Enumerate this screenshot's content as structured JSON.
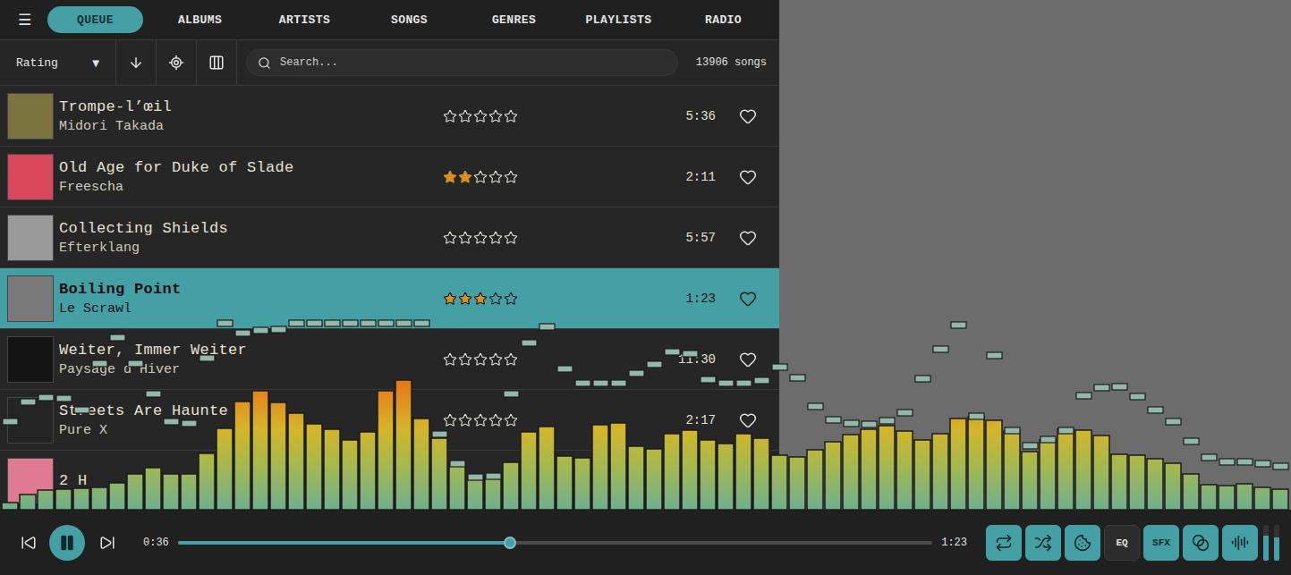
{
  "menu": {
    "glyph": "☰"
  },
  "tabs": [
    {
      "label": "QUEUE",
      "selected": true
    },
    {
      "label": "ALBUMS",
      "selected": false
    },
    {
      "label": "ARTISTS",
      "selected": false
    },
    {
      "label": "SONGS",
      "selected": false
    },
    {
      "label": "GENRES",
      "selected": false
    },
    {
      "label": "PLAYLISTS",
      "selected": false
    },
    {
      "label": "RADIO",
      "selected": false
    }
  ],
  "toolbar": {
    "sort": {
      "label": "Rating",
      "caret": "▼"
    },
    "search": {
      "placeholder": "Search..."
    },
    "count": "13906 songs"
  },
  "queue": [
    {
      "title": "Trompe-l’œil",
      "artist": "Midori Takada",
      "stars": 0,
      "duration": "5:36",
      "favorite": false,
      "selected": false,
      "color": "#7b7440"
    },
    {
      "title": "Old Age for Duke of Slade",
      "artist": "Freescha",
      "stars": 2,
      "duration": "2:11",
      "favorite": false,
      "selected": false,
      "color": "#d9475c"
    },
    {
      "title": "Collecting Shields",
      "artist": "Efterklang",
      "stars": 0,
      "duration": "5:57",
      "favorite": false,
      "selected": false,
      "color": "#9a9a9a"
    },
    {
      "title": "Boiling Point",
      "artist": "Le Scrawl",
      "stars": 3,
      "duration": "1:23",
      "favorite": false,
      "selected": true,
      "color": "#7a7a7a"
    },
    {
      "title": "Weiter, Immer Weiter",
      "artist": "Paysage d'Hiver",
      "stars": 0,
      "duration": "11:30",
      "favorite": false,
      "selected": false,
      "color": "#141414"
    },
    {
      "title": "Streets Are Haunte",
      "artist": "Pure X",
      "stars": 0,
      "duration": "2:17",
      "favorite": false,
      "selected": false,
      "color": "#242424"
    },
    {
      "title": "2 H",
      "selected": false,
      "color": "#e07a92"
    }
  ],
  "visualizer": {
    "max": 220,
    "bars": [
      8,
      17,
      22,
      23,
      24,
      25,
      30,
      40,
      47,
      40,
      40,
      63,
      91,
      121,
      133,
      120,
      108,
      96,
      90,
      78,
      87,
      133,
      145,
      102,
      80,
      51,
      35,
      37,
      53,
      87,
      93,
      60,
      58,
      95,
      97,
      71,
      68,
      85,
      89,
      78,
      74,
      85,
      80,
      61,
      59,
      67,
      76,
      84,
      90,
      94,
      88,
      78,
      85,
      102,
      104,
      100,
      88,
      65,
      78,
      90,
      89,
      83,
      62,
      61,
      57,
      52,
      40,
      28,
      27,
      29,
      25,
      23
    ],
    "peaks": [
      102,
      124,
      129,
      128,
      115,
      167,
      196,
      167,
      133,
      102,
      100,
      173,
      212,
      201,
      204,
      205,
      212,
      212,
      212,
      212,
      212,
      212,
      212,
      212,
      88,
      55,
      40,
      41,
      133,
      190,
      208,
      161,
      145,
      145,
      145,
      156,
      166,
      180,
      178,
      149,
      145,
      145,
      148,
      163,
      151,
      119,
      104,
      100,
      99,
      103,
      112,
      150,
      183,
      210,
      108,
      176,
      92,
      75,
      82,
      92,
      131,
      140,
      141,
      130,
      115,
      102,
      80,
      62,
      57,
      57,
      55,
      52
    ]
  },
  "player": {
    "playing": true,
    "elapsed": "0:36",
    "total": "1:23",
    "level": 0.44,
    "buttons": [
      {
        "kind": "repeat",
        "on": true
      },
      {
        "kind": "shuffle",
        "on": true
      },
      {
        "kind": "cookie",
        "on": true
      },
      {
        "kind": "text",
        "label": "EQ",
        "on": false
      },
      {
        "kind": "text",
        "label": "SFX",
        "on": true
      },
      {
        "kind": "blend",
        "on": true
      },
      {
        "kind": "wave",
        "on": true
      }
    ],
    "meters": [
      {
        "level": 0.7
      },
      {
        "level": 0.65
      }
    ]
  }
}
